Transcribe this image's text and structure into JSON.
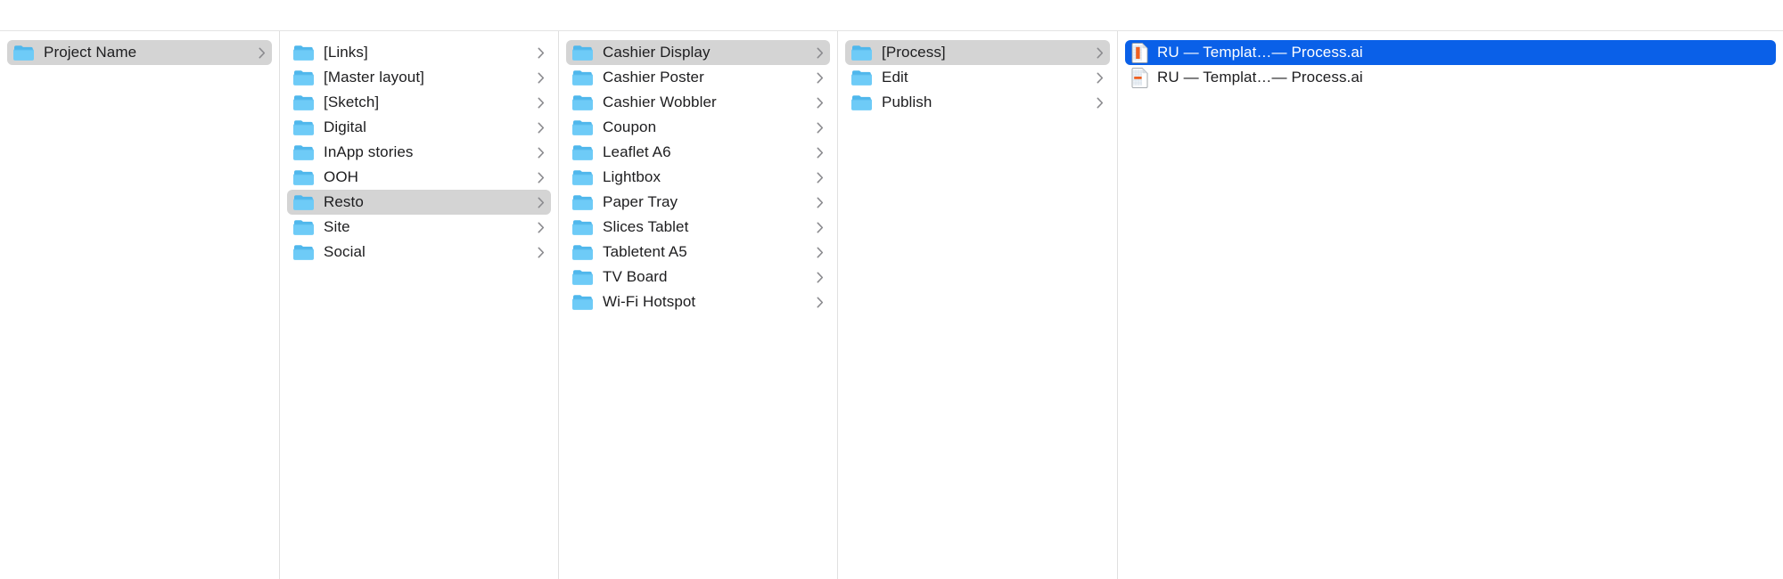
{
  "window": {
    "title": "Finder",
    "view_mode": "column",
    "accent_color": "#0a60e8",
    "selection_inactive_color": "#d4d4d4",
    "folder_icon_color": "#5ac8f5",
    "ai_icon_color": "#ef6021"
  },
  "columns": [
    {
      "name": "column-1",
      "items": [
        {
          "label": "Project Name",
          "kind": "folder",
          "icon": "folder-icon",
          "chevron": true,
          "selected": "inactive"
        }
      ]
    },
    {
      "name": "column-2",
      "items": [
        {
          "label": "[Links]",
          "kind": "folder",
          "icon": "folder-icon",
          "chevron": true,
          "selected": "none"
        },
        {
          "label": "[Master layout]",
          "kind": "folder",
          "icon": "folder-icon",
          "chevron": true,
          "selected": "none"
        },
        {
          "label": "[Sketch]",
          "kind": "folder",
          "icon": "folder-icon",
          "chevron": true,
          "selected": "none"
        },
        {
          "label": "Digital",
          "kind": "folder",
          "icon": "folder-icon",
          "chevron": true,
          "selected": "none"
        },
        {
          "label": "InApp stories",
          "kind": "folder",
          "icon": "folder-icon",
          "chevron": true,
          "selected": "none"
        },
        {
          "label": "OOH",
          "kind": "folder",
          "icon": "folder-icon",
          "chevron": true,
          "selected": "none"
        },
        {
          "label": "Resto",
          "kind": "folder",
          "icon": "folder-icon",
          "chevron": true,
          "selected": "inactive"
        },
        {
          "label": "Site",
          "kind": "folder",
          "icon": "folder-icon",
          "chevron": true,
          "selected": "none"
        },
        {
          "label": "Social",
          "kind": "folder",
          "icon": "folder-icon",
          "chevron": true,
          "selected": "none"
        }
      ]
    },
    {
      "name": "column-3",
      "items": [
        {
          "label": "Cashier Display",
          "kind": "folder",
          "icon": "folder-icon",
          "chevron": true,
          "selected": "inactive"
        },
        {
          "label": "Cashier Poster",
          "kind": "folder",
          "icon": "folder-icon",
          "chevron": true,
          "selected": "none"
        },
        {
          "label": "Cashier Wobbler",
          "kind": "folder",
          "icon": "folder-icon",
          "chevron": true,
          "selected": "none"
        },
        {
          "label": "Coupon",
          "kind": "folder",
          "icon": "folder-icon",
          "chevron": true,
          "selected": "none"
        },
        {
          "label": "Leaflet A6",
          "kind": "folder",
          "icon": "folder-icon",
          "chevron": true,
          "selected": "none"
        },
        {
          "label": "Lightbox",
          "kind": "folder",
          "icon": "folder-icon",
          "chevron": true,
          "selected": "none"
        },
        {
          "label": "Paper Tray",
          "kind": "folder",
          "icon": "folder-icon",
          "chevron": true,
          "selected": "none"
        },
        {
          "label": "Slices Tablet",
          "kind": "folder",
          "icon": "folder-icon",
          "chevron": true,
          "selected": "none"
        },
        {
          "label": "Tabletent A5",
          "kind": "folder",
          "icon": "folder-icon",
          "chevron": true,
          "selected": "none"
        },
        {
          "label": "TV Board",
          "kind": "folder",
          "icon": "folder-icon",
          "chevron": true,
          "selected": "none"
        },
        {
          "label": "Wi-Fi Hotspot",
          "kind": "folder",
          "icon": "folder-icon",
          "chevron": true,
          "selected": "none"
        }
      ]
    },
    {
      "name": "column-4",
      "items": [
        {
          "label": "[Process]",
          "kind": "folder",
          "icon": "folder-icon",
          "chevron": true,
          "selected": "inactive"
        },
        {
          "label": "Edit",
          "kind": "folder",
          "icon": "folder-icon",
          "chevron": true,
          "selected": "none"
        },
        {
          "label": "Publish",
          "kind": "folder",
          "icon": "folder-icon",
          "chevron": true,
          "selected": "none"
        }
      ]
    },
    {
      "name": "column-5",
      "items": [
        {
          "label": "RU — Templat…— Process.ai",
          "kind": "file",
          "icon": "illustrator-file-icon",
          "chevron": false,
          "selected": "active"
        },
        {
          "label": "RU — Templat…— Process.ai",
          "kind": "file",
          "icon": "illustrator-alias-file-icon",
          "chevron": false,
          "selected": "none"
        }
      ]
    }
  ]
}
